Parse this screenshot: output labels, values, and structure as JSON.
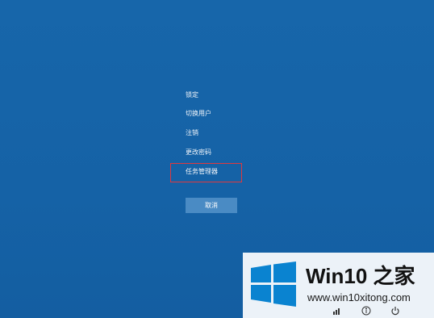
{
  "menu": {
    "items": [
      {
        "label": "锁定"
      },
      {
        "label": "切换用户"
      },
      {
        "label": "注销"
      },
      {
        "label": "更改密码"
      },
      {
        "label": "任务管理器"
      }
    ],
    "highlight_color": "#e0393e"
  },
  "cancel_button": {
    "label": "取消"
  },
  "watermark": {
    "brand": "Win10 之家",
    "site": "www.win10xitong.com"
  },
  "tray": {
    "icons": [
      "network-icon",
      "accessibility-icon",
      "power-icon"
    ]
  },
  "colors": {
    "background": "#1664a8",
    "button": "#4a8bc4"
  }
}
